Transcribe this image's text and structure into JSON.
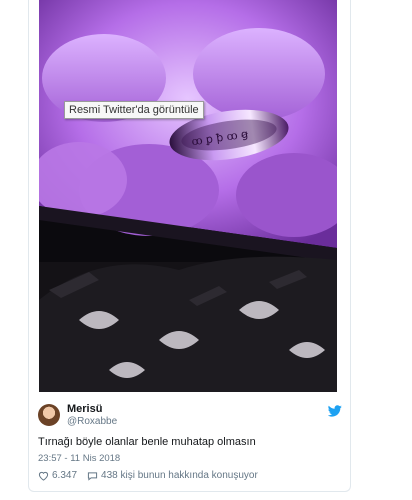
{
  "media": {
    "tooltip": "Resmi Twitter'da görüntüle"
  },
  "tweet": {
    "display_name": "Merisü",
    "handle": "@Roxabbe",
    "text": "Tırnağı böyle olanlar benle muhatap olmasın",
    "timestamp": "23:57 - 11 Nis 2018",
    "likes": "6.347",
    "replies_text": "438 kişi bunun hakkında konuşuyor"
  },
  "colors": {
    "accent": "#1da1f2",
    "muted": "#657786",
    "screen_glow": "#c89af0"
  }
}
